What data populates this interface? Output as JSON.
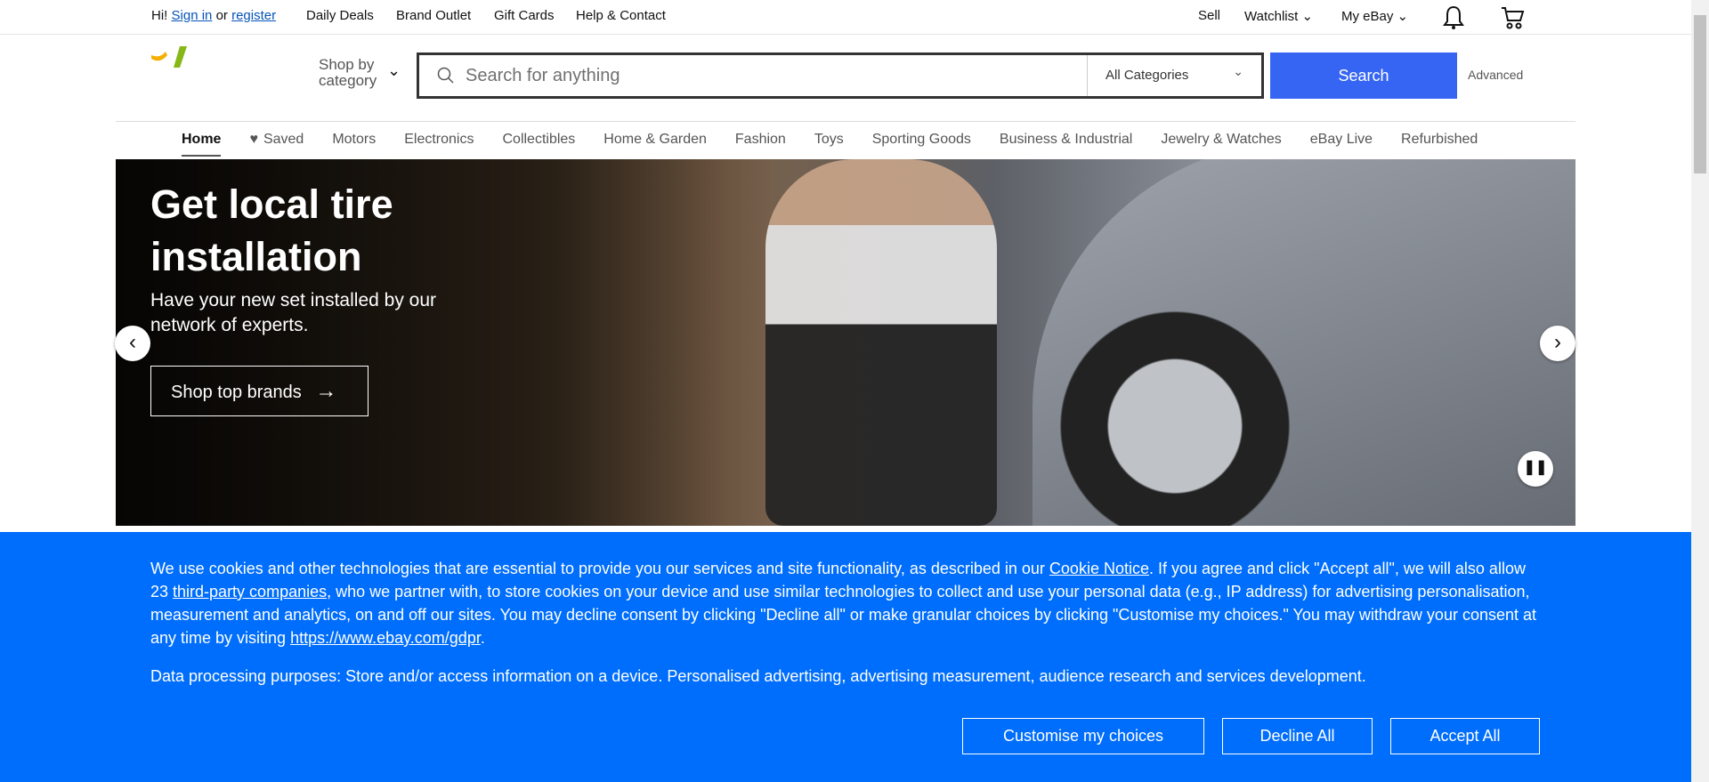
{
  "topbar": {
    "hi": "Hi!",
    "sign_in": "Sign in",
    "or": "or",
    "register": "register",
    "links": [
      "Daily Deals",
      "Brand Outlet",
      "Gift Cards",
      "Help & Contact"
    ],
    "sell": "Sell",
    "watchlist": "Watchlist",
    "myebay": "My eBay"
  },
  "header": {
    "shop_by_1": "Shop by",
    "shop_by_2": "category",
    "search_placeholder": "Search for anything",
    "category": "All Categories",
    "search_button": "Search",
    "advanced": "Advanced"
  },
  "nav": [
    "Home",
    "Saved",
    "Motors",
    "Electronics",
    "Collectibles",
    "Home & Garden",
    "Fashion",
    "Toys",
    "Sporting Goods",
    "Business & Industrial",
    "Jewelry & Watches",
    "eBay Live",
    "Refurbished"
  ],
  "hero": {
    "title": "Get local tire installation",
    "subtitle": "Have your new set installed by our network of experts.",
    "button": "Shop top brands"
  },
  "cookie": {
    "p1a": "We use cookies and other technologies that are essential to provide you our services and site functionality, as described in our ",
    "cookie_notice": "Cookie Notice",
    "p1b": ". If you agree and click \"Accept all\", we will also allow 23 ",
    "third_party": "third-party companies",
    "p1c": ", who we partner with, to store cookies on your device and use similar technologies to collect and use your personal data (e.g., IP address) for advertising personalisation, measurement and analytics, on and off our sites. You may decline consent by clicking \"Decline all\" or make granular choices by clicking \"Customise my choices.\" You may withdraw your consent at any time by visiting ",
    "gdpr": "https://www.ebay.com/gdpr",
    "p1d": ".",
    "data_processing": "Data processing purposes: Store and/or access information on a device. Personalised advertising, advertising measurement, audience research and services development.",
    "customise": "Customise my choices",
    "decline": "Decline All",
    "accept": "Accept All"
  }
}
